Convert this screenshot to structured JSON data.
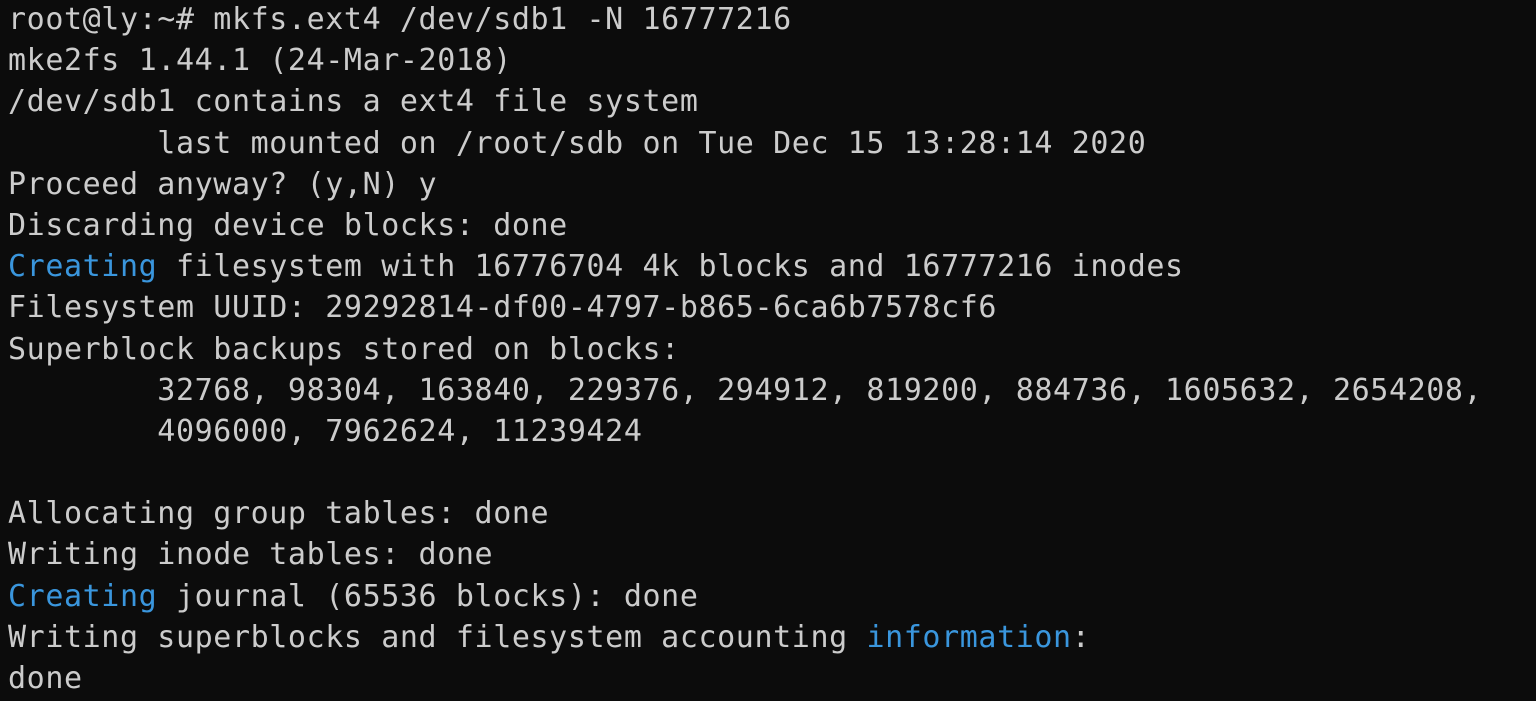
{
  "colors": {
    "background": "#0c0c0c",
    "foreground": "#cccccc",
    "highlight": "#3a96dd"
  },
  "lines": [
    {
      "text": "root@ly:~# mkfs.ext4 /dev/sdb1 -N 16777216"
    },
    {
      "text": "mke2fs 1.44.1 (24-Mar-2018)"
    },
    {
      "text": "/dev/sdb1 contains a ext4 file system"
    },
    {
      "text": "        last mounted on /root/sdb on Tue Dec 15 13:28:14 2020"
    },
    {
      "text": "Proceed anyway? (y,N) y"
    },
    {
      "text": "Discarding device blocks: done"
    },
    {
      "hl": "Creating",
      "text": " filesystem with 16776704 4k blocks and 16777216 inodes"
    },
    {
      "text": "Filesystem UUID: 29292814-df00-4797-b865-6ca6b7578cf6"
    },
    {
      "text": "Superblock backups stored on blocks:"
    },
    {
      "text": "        32768, 98304, 163840, 229376, 294912, 819200, 884736, 1605632, 2654208,"
    },
    {
      "text": "        4096000, 7962624, 11239424"
    },
    {
      "text": ""
    },
    {
      "text": "Allocating group tables: done"
    },
    {
      "text": "Writing inode tables: done"
    },
    {
      "hl": "Creating",
      "text": " journal (65536 blocks): done"
    },
    {
      "text": "Writing superblocks and filesystem accounting ",
      "hl2": "information",
      "tail": ":"
    },
    {
      "text": "done"
    }
  ]
}
